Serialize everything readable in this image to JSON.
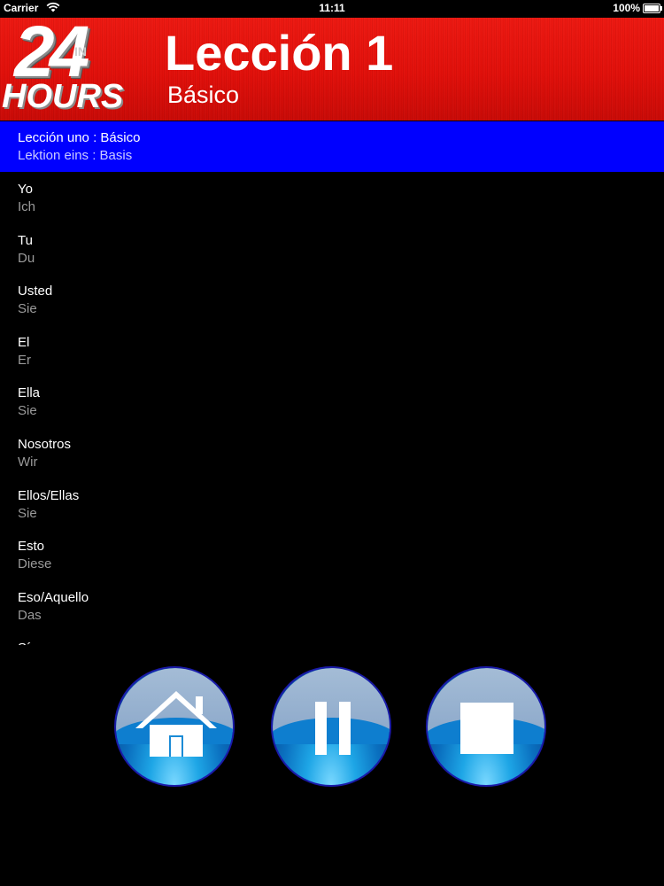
{
  "status_bar": {
    "carrier": "Carrier",
    "time": "11:11",
    "battery": "100%",
    "wifi_icon": "wifi-icon",
    "battery_icon": "battery-icon"
  },
  "header": {
    "logo_number": "24",
    "logo_in": "IN",
    "logo_word": "HOURS",
    "title": "Lección 1",
    "subtitle": "Básico",
    "background_color": "#e3100a"
  },
  "selected_item": {
    "primary": "Lección uno : Básico",
    "secondary": "Lektion eins : Basis",
    "highlight_color": "#0000ff"
  },
  "list": [
    {
      "primary": "Yo",
      "secondary": "Ich"
    },
    {
      "primary": "Tu",
      "secondary": "Du"
    },
    {
      "primary": "Usted",
      "secondary": "Sie"
    },
    {
      "primary": "El",
      "secondary": "Er"
    },
    {
      "primary": "Ella",
      "secondary": "Sie"
    },
    {
      "primary": "Nosotros",
      "secondary": "Wir"
    },
    {
      "primary": "Ellos/Ellas",
      "secondary": "Sie"
    },
    {
      "primary": "Esto",
      "secondary": "Diese"
    },
    {
      "primary": "Eso/Aquello",
      "secondary": "Das"
    },
    {
      "primary": "Sí",
      "secondary": ""
    }
  ],
  "controls": {
    "home_icon": "home-icon",
    "pause_icon": "pause-icon",
    "stop_icon": "stop-icon"
  }
}
